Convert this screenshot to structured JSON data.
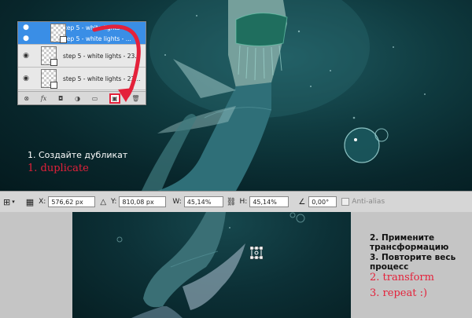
{
  "layers_panel": {
    "layers": [
      {
        "name": "step 5 - white lights - ...",
        "selected": true
      },
      {
        "name": "step 5 - white lights - ...",
        "selected": true
      },
      {
        "name": "step 5 - white lights - 23...",
        "selected": false
      },
      {
        "name": "step 5 - white lights - 23...",
        "selected": false
      }
    ],
    "footer_icons": [
      "link-icon",
      "fx-icon",
      "mask-icon",
      "adjustment-icon",
      "folder-icon",
      "new-layer-icon",
      "trash-icon"
    ],
    "fx_label": "fx",
    "selected_color": "#3a8ee6"
  },
  "captions": {
    "step1_ru": "1. Создайте дубликат",
    "step1_en": "1. duplicate",
    "step2_ru": "2. Примените трансформацию",
    "step3_ru": "3. Повторите весь процесс",
    "step2_en": "2. transform",
    "step3_en": "3. repeat :)"
  },
  "toolbar": {
    "x_label": "X:",
    "x_value": "576,62 px",
    "y_label": "Y:",
    "y_value": "810,08 px",
    "w_label": "W:",
    "w_value": "45,14%",
    "h_label": "H:",
    "h_value": "45,14%",
    "angle_value": "0,00",
    "angle_unit": "°",
    "antialias_label": "Anti-alias"
  },
  "colors": {
    "arrow_red": "#e4213a",
    "caption_red": "#e4213a"
  }
}
